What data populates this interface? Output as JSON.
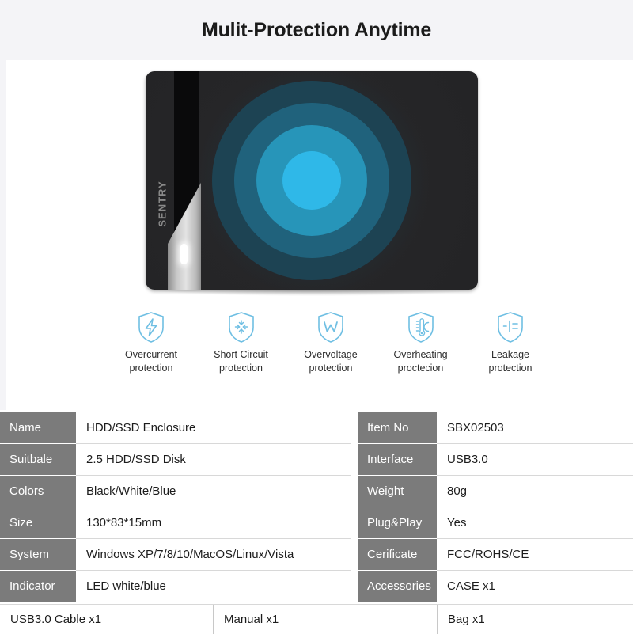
{
  "header": {
    "title": "Mulit-Protection Anytime"
  },
  "product_image": {
    "brand": "SENTRY",
    "brand_mark_icon": "dot-icon",
    "led_indicator_icon": "led-indicator-icon",
    "glow_colors": {
      "ring_1": "#2fb8e8",
      "ring_2": "#2795b9",
      "ring_3": "#20627c",
      "ring_4": "#1d4353"
    }
  },
  "features": [
    {
      "icon": "shield-lightning-icon",
      "line1": "Overcurrent",
      "line2": "protection"
    },
    {
      "icon": "shield-short-circuit-icon",
      "line1": "Short Circuit",
      "line2": "protection"
    },
    {
      "icon": "shield-voltage-w-icon",
      "line1": "Overvoltage",
      "line2": "protection"
    },
    {
      "icon": "shield-thermometer-icon",
      "line1": "Overheating",
      "line2": "proctecion"
    },
    {
      "icon": "shield-leakage-icon",
      "line1": "Leakage",
      "line2": "protection"
    }
  ],
  "feature_icon_color": "#6fbfe3",
  "specs_left": [
    {
      "label": "Name",
      "value": "HDD/SSD Enclosure"
    },
    {
      "label": "Suitbale",
      "value": "2.5 HDD/SSD Disk"
    },
    {
      "label": "Colors",
      "value": "Black/White/Blue"
    },
    {
      "label": "Size",
      "value": "130*83*15mm"
    },
    {
      "label": "System",
      "value": "Windows XP/7/8/10/MacOS/Linux/Vista"
    },
    {
      "label": "Indicator",
      "value": "LED white/blue"
    }
  ],
  "specs_right": [
    {
      "label": "Item No",
      "value": "SBX02503"
    },
    {
      "label": "Interface",
      "value": "USB3.0"
    },
    {
      "label": "Weight",
      "value": "80g"
    },
    {
      "label": "Plug&Play",
      "value": "Yes"
    },
    {
      "label": "Cerificate",
      "value": "FCC/ROHS/CE"
    },
    {
      "label": "Accessories",
      "value": "CASE x1"
    }
  ],
  "accessories": [
    "USB3.0 Cable x1",
    "Manual x1",
    "Bag x1"
  ]
}
